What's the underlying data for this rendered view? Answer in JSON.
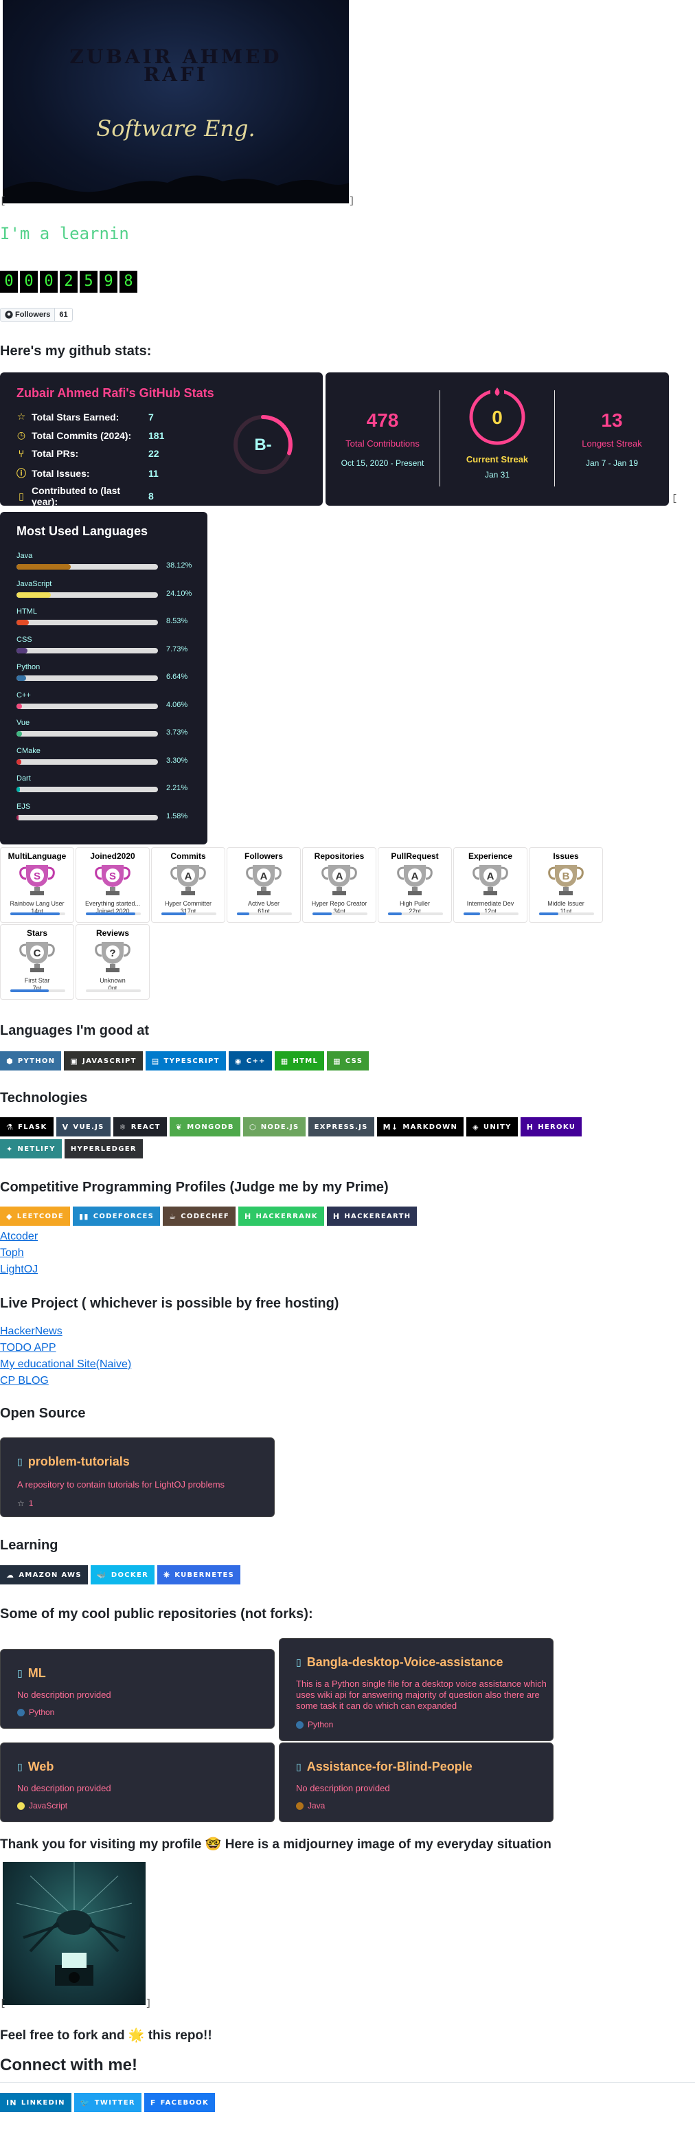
{
  "banner": {
    "name_line1": "ZUBAIR AHMED",
    "name_line2": "RAFI",
    "subtitle": "Software Eng."
  },
  "typing_text": "I'm a learnin",
  "visitor_counter": [
    "0",
    "0",
    "0",
    "2",
    "5",
    "9",
    "8"
  ],
  "followers": {
    "label": "Followers",
    "count": "61"
  },
  "headings": {
    "stats": "Here's my github stats:",
    "languages_good": "Languages I'm good at",
    "technologies": "Technologies",
    "cp": "Competitive Programming Profiles (Judge me by my Prime)",
    "live": "Live Project ( whichever is possible by free hosting)",
    "open_source": "Open Source",
    "learning": "Learning",
    "repos": "Some of my cool public repositories (not forks):",
    "thanks": "Thank you for visiting my profile 🤓 Here is a midjourney image of my everyday situation",
    "fork": "Feel free to fork and 🌟 this repo!!",
    "connect": "Connect with me!"
  },
  "stats_card": {
    "title": "Zubair Ahmed Rafi's GitHub Stats",
    "rows": [
      {
        "icon": "star-icon",
        "label": "Total Stars Earned:",
        "value": "7"
      },
      {
        "icon": "clock-icon",
        "label": "Total Commits (2024):",
        "value": "181"
      },
      {
        "icon": "pull-request-icon",
        "label": "Total PRs:",
        "value": "22"
      },
      {
        "icon": "issue-icon",
        "label": "Total Issues:",
        "value": "11"
      },
      {
        "icon": "repo-icon",
        "label": "Contributed to (last year):",
        "value": "8"
      }
    ],
    "grade": "B-",
    "grade_progress": 0.3
  },
  "streak_card": {
    "total": {
      "value": "478",
      "label": "Total Contributions",
      "range": "Oct 15, 2020 - Present"
    },
    "current": {
      "value": "0",
      "label": "Current Streak",
      "range": "Jan 31"
    },
    "longest": {
      "value": "13",
      "label": "Longest Streak",
      "range": "Jan 7 - Jan 19"
    }
  },
  "languages_card": {
    "title": "Most Used Languages",
    "items": [
      {
        "name": "Java",
        "percent": "38.12%",
        "value": 38.12,
        "color": "#b07219"
      },
      {
        "name": "JavaScript",
        "percent": "24.10%",
        "value": 24.1,
        "color": "#f1e05a"
      },
      {
        "name": "HTML",
        "percent": "8.53%",
        "value": 8.53,
        "color": "#e34c26"
      },
      {
        "name": "CSS",
        "percent": "7.73%",
        "value": 7.73,
        "color": "#563d7c"
      },
      {
        "name": "Python",
        "percent": "6.64%",
        "value": 6.64,
        "color": "#3572A5"
      },
      {
        "name": "C++",
        "percent": "4.06%",
        "value": 4.06,
        "color": "#f34b7d"
      },
      {
        "name": "Vue",
        "percent": "3.73%",
        "value": 3.73,
        "color": "#41b883"
      },
      {
        "name": "CMake",
        "percent": "3.30%",
        "value": 3.3,
        "color": "#DA3434"
      },
      {
        "name": "Dart",
        "percent": "2.21%",
        "value": 2.21,
        "color": "#00B4AB"
      },
      {
        "name": "EJS",
        "percent": "1.58%",
        "value": 1.58,
        "color": "#a91e50"
      }
    ]
  },
  "trophies": [
    {
      "title": "MultiLanguage",
      "rank": "S",
      "sub": "Rainbow Lang User",
      "pts": "14pt",
      "progress": 0.9,
      "color": "#c03aa9"
    },
    {
      "title": "Joined2020",
      "rank": "S",
      "sub": "Everything started...",
      "pts": "Joined 2020",
      "progress": 0.9,
      "color": "#c03aa9"
    },
    {
      "title": "Commits",
      "rank": "A",
      "sub": "Hyper Committer",
      "pts": "317pt",
      "progress": 0.45,
      "color": "#999999"
    },
    {
      "title": "Followers",
      "rank": "A",
      "sub": "Active User",
      "pts": "61pt",
      "progress": 0.22,
      "color": "#999999"
    },
    {
      "title": "Repositories",
      "rank": "A",
      "sub": "Hyper Repo Creator",
      "pts": "34pt",
      "progress": 0.35,
      "color": "#999999"
    },
    {
      "title": "PullRequest",
      "rank": "A",
      "sub": "High Puller",
      "pts": "22pt",
      "progress": 0.25,
      "color": "#999999"
    },
    {
      "title": "Experience",
      "rank": "A",
      "sub": "Intermediate Dev",
      "pts": "12pt",
      "progress": 0.3,
      "color": "#999999"
    },
    {
      "title": "Issues",
      "rank": "B",
      "sub": "Middle Issuer",
      "pts": "11pt",
      "progress": 0.35,
      "color": "#a8936a"
    },
    {
      "title": "Stars",
      "rank": "C",
      "sub": "First Star",
      "pts": "7pt",
      "progress": 0.7,
      "color": "#999999"
    },
    {
      "title": "Reviews",
      "rank": "?",
      "sub": "Unknown",
      "pts": "0pt",
      "progress": 0.0,
      "color": "#999999"
    }
  ],
  "languages_badges": [
    {
      "label": "Python",
      "bg": "#3670A0",
      "icon": "python-icon",
      "glyph": "⬢"
    },
    {
      "label": "JavaScript",
      "bg": "#323330",
      "icon": "javascript-icon",
      "glyph": "▣"
    },
    {
      "label": "TypeScript",
      "bg": "#007ACC",
      "icon": "typescript-icon",
      "glyph": "▤"
    },
    {
      "label": "C++",
      "bg": "#00599C",
      "icon": "cplusplus-icon",
      "glyph": "◉"
    },
    {
      "label": "HTML",
      "bg": "#1fa51f",
      "icon": "html-icon",
      "glyph": "▦"
    },
    {
      "label": "CSS",
      "bg": "#3d9b33",
      "icon": "css-icon",
      "glyph": "▦"
    }
  ],
  "tech_badges": [
    {
      "label": "Flask",
      "bg": "#000000",
      "icon": "flask-icon",
      "glyph": "⚗"
    },
    {
      "label": "Vue.js",
      "bg": "#35495e",
      "icon": "vue-icon",
      "glyph": "V"
    },
    {
      "label": "React",
      "bg": "#20232a",
      "icon": "react-icon",
      "glyph": "⚛"
    },
    {
      "label": "MongoDB",
      "bg": "#4ea94b",
      "icon": "mongodb-icon",
      "glyph": "❦"
    },
    {
      "label": "Node.js",
      "bg": "#6DA55F",
      "icon": "nodejs-icon",
      "glyph": "⬡"
    },
    {
      "label": "Express.js",
      "bg": "#404d59",
      "icon": "express-icon",
      "glyph": ""
    },
    {
      "label": "Markdown",
      "bg": "#000000",
      "icon": "markdown-icon",
      "glyph": "M↓"
    },
    {
      "label": "Unity",
      "bg": "#000000",
      "icon": "unity-icon",
      "glyph": "◈"
    },
    {
      "label": "Heroku",
      "bg": "#430098",
      "icon": "heroku-icon",
      "glyph": "H"
    },
    {
      "label": "Netlify",
      "bg": "#2c8a8a",
      "icon": "netlify-icon",
      "glyph": "✦"
    },
    {
      "label": "Hyperledger",
      "bg": "#2F3134",
      "icon": "hyperledger-icon",
      "glyph": ""
    }
  ],
  "cp_badges": [
    {
      "label": "LeetCode",
      "bg": "#f5a623",
      "icon": "leetcode-icon",
      "glyph": "◆"
    },
    {
      "label": "Codeforces",
      "bg": "#1f8acb",
      "icon": "codeforces-icon",
      "glyph": "▮▮"
    },
    {
      "label": "CodeChef",
      "bg": "#5B4638",
      "icon": "codechef-icon",
      "glyph": "☕"
    },
    {
      "label": "HackerRank",
      "bg": "#2EC866",
      "icon": "hackerrank-icon",
      "glyph": "H"
    },
    {
      "label": "HackerEarth",
      "bg": "#2C3454",
      "icon": "hackerearth-icon",
      "glyph": "H"
    }
  ],
  "cp_links": [
    "Atcoder",
    "Toph",
    "LightOJ"
  ],
  "live_links": [
    "HackerNews",
    "TODO APP",
    "My educational Site(Naive)",
    "CP BLOG"
  ],
  "open_source_repo": {
    "name": "problem-tutorials",
    "desc": "A repository to contain tutorials for LightOJ problems",
    "stars": "1"
  },
  "learning_badges": [
    {
      "label": "Amazon AWS",
      "bg": "#232F3E",
      "icon": "aws-icon",
      "glyph": "☁"
    },
    {
      "label": "Docker",
      "bg": "#0db7ed",
      "icon": "docker-icon",
      "glyph": "🐳"
    },
    {
      "label": "Kubernetes",
      "bg": "#326ce5",
      "icon": "kubernetes-icon",
      "glyph": "⎈"
    }
  ],
  "repos": [
    {
      "name": "ML",
      "desc": "No description provided",
      "lang": "Python",
      "lang_color": "#3572A5"
    },
    {
      "name": "Bangla-desktop-Voice-assistance",
      "desc": "This is a Python single file for a desktop voice assistance which uses wiki api for answering majority of question also there are some task it can do which can expanded",
      "lang": "Python",
      "lang_color": "#3572A5"
    },
    {
      "name": "Web",
      "desc": "No description provided",
      "lang": "JavaScript",
      "lang_color": "#f1e05a"
    },
    {
      "name": "Assistance-for-Blind-People",
      "desc": "No description provided",
      "lang": "Java",
      "lang_color": "#b07219"
    }
  ],
  "social_badges": [
    {
      "label": "LinkedIn",
      "bg": "#0077B5",
      "icon": "linkedin-icon",
      "glyph": "in"
    },
    {
      "label": "Twitter",
      "bg": "#1DA1F2",
      "icon": "twitter-icon",
      "glyph": "🐦"
    },
    {
      "label": "Facebook",
      "bg": "#1877F2",
      "icon": "facebook-icon",
      "glyph": "f"
    }
  ]
}
